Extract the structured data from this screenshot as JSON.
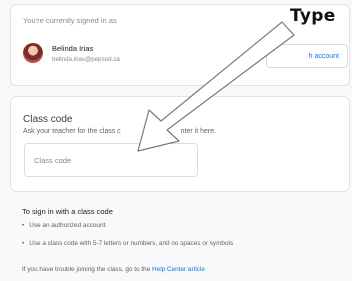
{
  "account": {
    "signed_in_label": "You're currently signed in as",
    "name": "Belinda Irias",
    "email": "belinda.irias@pepsod.ca",
    "switch_button": "h account"
  },
  "class_code": {
    "title": "Class code",
    "description": "Ask your teacher for the class c",
    "description_end": "nter it here.",
    "placeholder": "Class code"
  },
  "help": {
    "title": "To sign in with a class code",
    "items": [
      "Use an authorized account",
      "Use a class code with 5-7 letters or numbers, and no spaces or symbols"
    ],
    "trouble_text": "If you have trouble joining the class, go to the ",
    "trouble_link": "Help Center article"
  },
  "annotation": {
    "label": "Type",
    "arrow_icon": "pointer-arrow-icon",
    "arrow_color": "#ffffff"
  }
}
